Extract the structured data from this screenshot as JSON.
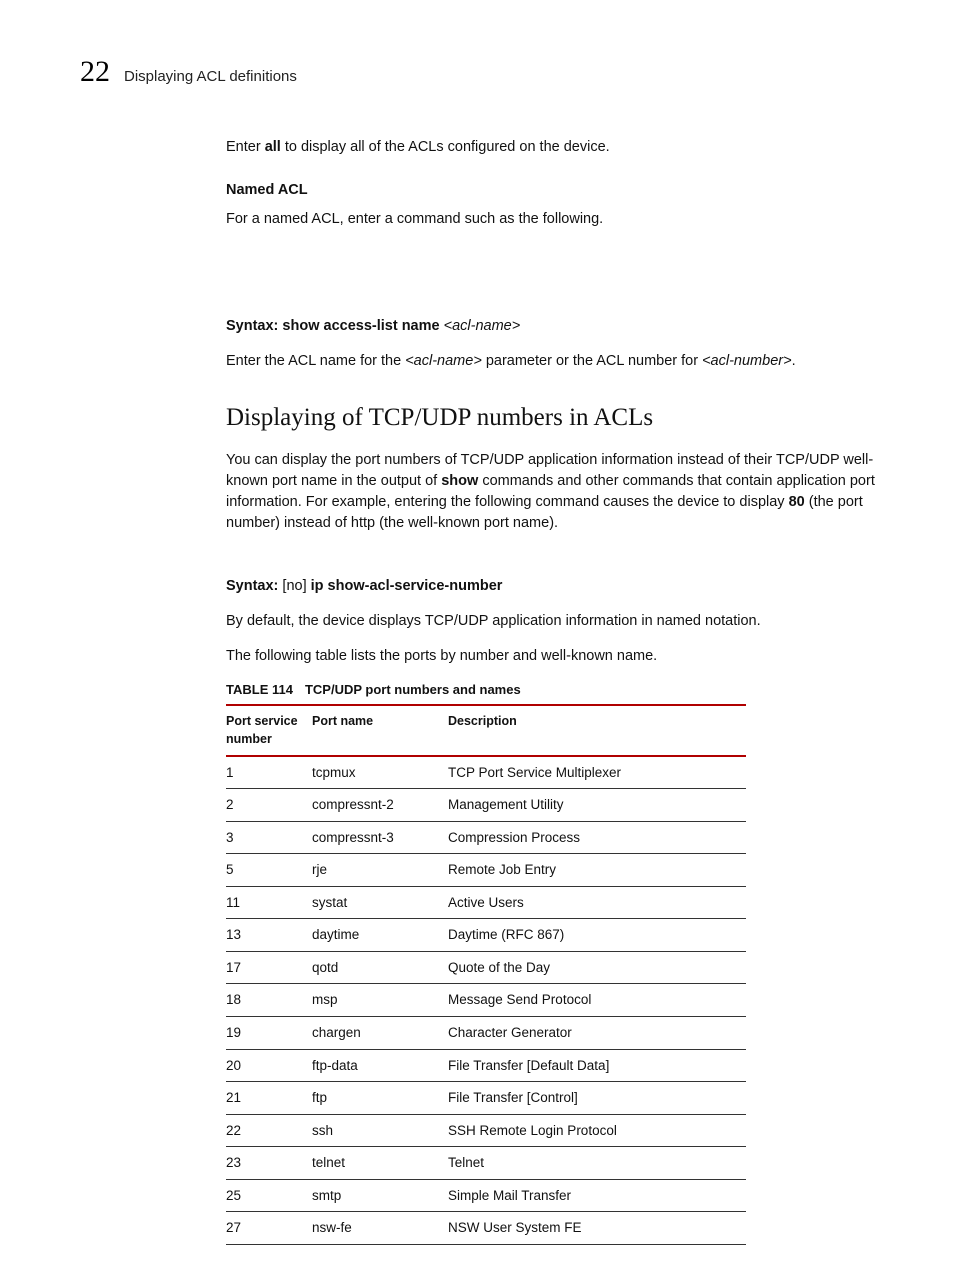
{
  "header": {
    "page_number": "22",
    "title": "Displaying ACL definitions"
  },
  "body": {
    "p_enter_all_1": "Enter ",
    "p_enter_all_bold": "all",
    "p_enter_all_2": " to display all of the ACLs configured on the device.",
    "named_acl_heading": "Named ACL",
    "p_named_acl": "For a named ACL, enter a command such as the following.",
    "syntax1_pre": "Syntax: ",
    "syntax1_bold": " show access-list name ",
    "syntax1_italic": "<acl-name>",
    "p_enter_aclname_1": "Enter the ACL name for the ",
    "p_enter_aclname_it1": "<acl-name>",
    "p_enter_aclname_2": " parameter or the ACL number for ",
    "p_enter_aclname_it2": "<acl-number>",
    "p_enter_aclname_3": ".",
    "section_heading": "Displaying of TCP/UDP numbers in ACLs",
    "p_display_1": "You can display the port numbers of TCP/UDP application information instead of their TCP/UDP well-known port name in the output of ",
    "p_display_bold1": "show",
    "p_display_2": " commands and other commands that contain application port information. For example, entering the following command causes the device to display ",
    "p_display_bold2": "80",
    "p_display_3": " (the port number) instead of http (the well-known port name).",
    "syntax2_pre": "Syntax: ",
    "syntax2_plain": " [no] ",
    "syntax2_bold": "ip show-acl-service-number",
    "p_default": "By default, the device displays TCP/UDP application information in named notation.",
    "p_table_intro": "The following table lists the ports by number and well-known name.",
    "table_label": "TABLE 114",
    "table_caption": "TCP/UDP port numbers and names",
    "col1": "Port service number",
    "col2": "Port name",
    "col3": "Description"
  },
  "rows": [
    {
      "num": "1",
      "name": "tcpmux",
      "desc": "TCP Port Service Multiplexer"
    },
    {
      "num": "2",
      "name": "compressnt-2",
      "desc": "Management Utility"
    },
    {
      "num": "3",
      "name": "compressnt-3",
      "desc": "Compression Process"
    },
    {
      "num": "5",
      "name": "rje",
      "desc": "Remote Job Entry"
    },
    {
      "num": "11",
      "name": "systat",
      "desc": "Active Users"
    },
    {
      "num": "13",
      "name": "daytime",
      "desc": "Daytime (RFC 867)"
    },
    {
      "num": "17",
      "name": "qotd",
      "desc": "Quote of the Day"
    },
    {
      "num": "18",
      "name": "msp",
      "desc": "Message Send Protocol"
    },
    {
      "num": "19",
      "name": "chargen",
      "desc": "Character Generator"
    },
    {
      "num": "20",
      "name": "ftp-data",
      "desc": "File Transfer [Default Data]"
    },
    {
      "num": "21",
      "name": "ftp",
      "desc": "File Transfer [Control]"
    },
    {
      "num": "22",
      "name": "ssh",
      "desc": "SSH Remote Login Protocol"
    },
    {
      "num": "23",
      "name": "telnet",
      "desc": "Telnet"
    },
    {
      "num": "25",
      "name": "smtp",
      "desc": "Simple Mail Transfer"
    },
    {
      "num": "27",
      "name": "nsw-fe",
      "desc": "NSW User System FE"
    }
  ]
}
